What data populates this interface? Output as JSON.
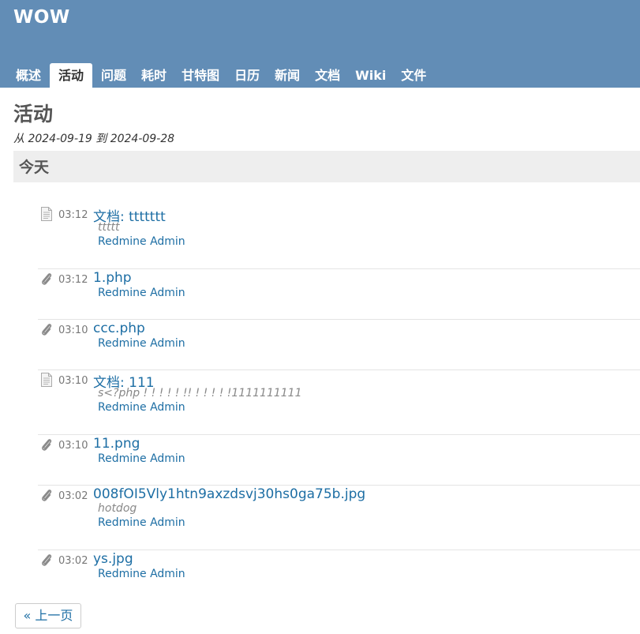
{
  "project": {
    "title": "WOW"
  },
  "menu": {
    "tabs": [
      {
        "label": "概述"
      },
      {
        "label": "活动",
        "selected": true
      },
      {
        "label": "问题"
      },
      {
        "label": "耗时"
      },
      {
        "label": "甘特图"
      },
      {
        "label": "日历"
      },
      {
        "label": "新闻"
      },
      {
        "label": "文档"
      },
      {
        "label": "Wiki"
      },
      {
        "label": "文件"
      }
    ]
  },
  "page": {
    "title": "活动",
    "date_range": "从 2024-09-19 到 2024-09-28",
    "day_header": "今天"
  },
  "entries": [
    {
      "icon": "document-icon",
      "time": "03:12",
      "title": "文档: ttttttt",
      "description": "ttttt",
      "author": "Redmine Admin"
    },
    {
      "icon": "attachment-icon",
      "time": "03:12",
      "title": "1.php",
      "description": "",
      "author": "Redmine Admin"
    },
    {
      "icon": "attachment-icon",
      "time": "03:10",
      "title": "ccc.php",
      "description": "",
      "author": "Redmine Admin"
    },
    {
      "icon": "document-icon",
      "time": "03:10",
      "title": "文档: 111",
      "description": "s<?php ! ! ! ! ! !! ! ! ! ! !1111111111",
      "author": "Redmine Admin"
    },
    {
      "icon": "attachment-icon",
      "time": "03:10",
      "title": "11.png",
      "description": "",
      "author": "Redmine Admin"
    },
    {
      "icon": "attachment-icon",
      "time": "03:02",
      "title": "008fOI5Vly1htn9axzdsvj30hs0ga75b.jpg",
      "description": "hotdog",
      "author": "Redmine Admin"
    },
    {
      "icon": "attachment-icon",
      "time": "03:02",
      "title": "ys.jpg",
      "description": "",
      "author": "Redmine Admin"
    }
  ],
  "pagination": {
    "previous_label": "« 上一页"
  },
  "colors": {
    "header_bg": "#628db6",
    "link": "#1d6ea4",
    "day_header_bg": "#eeeeee"
  }
}
